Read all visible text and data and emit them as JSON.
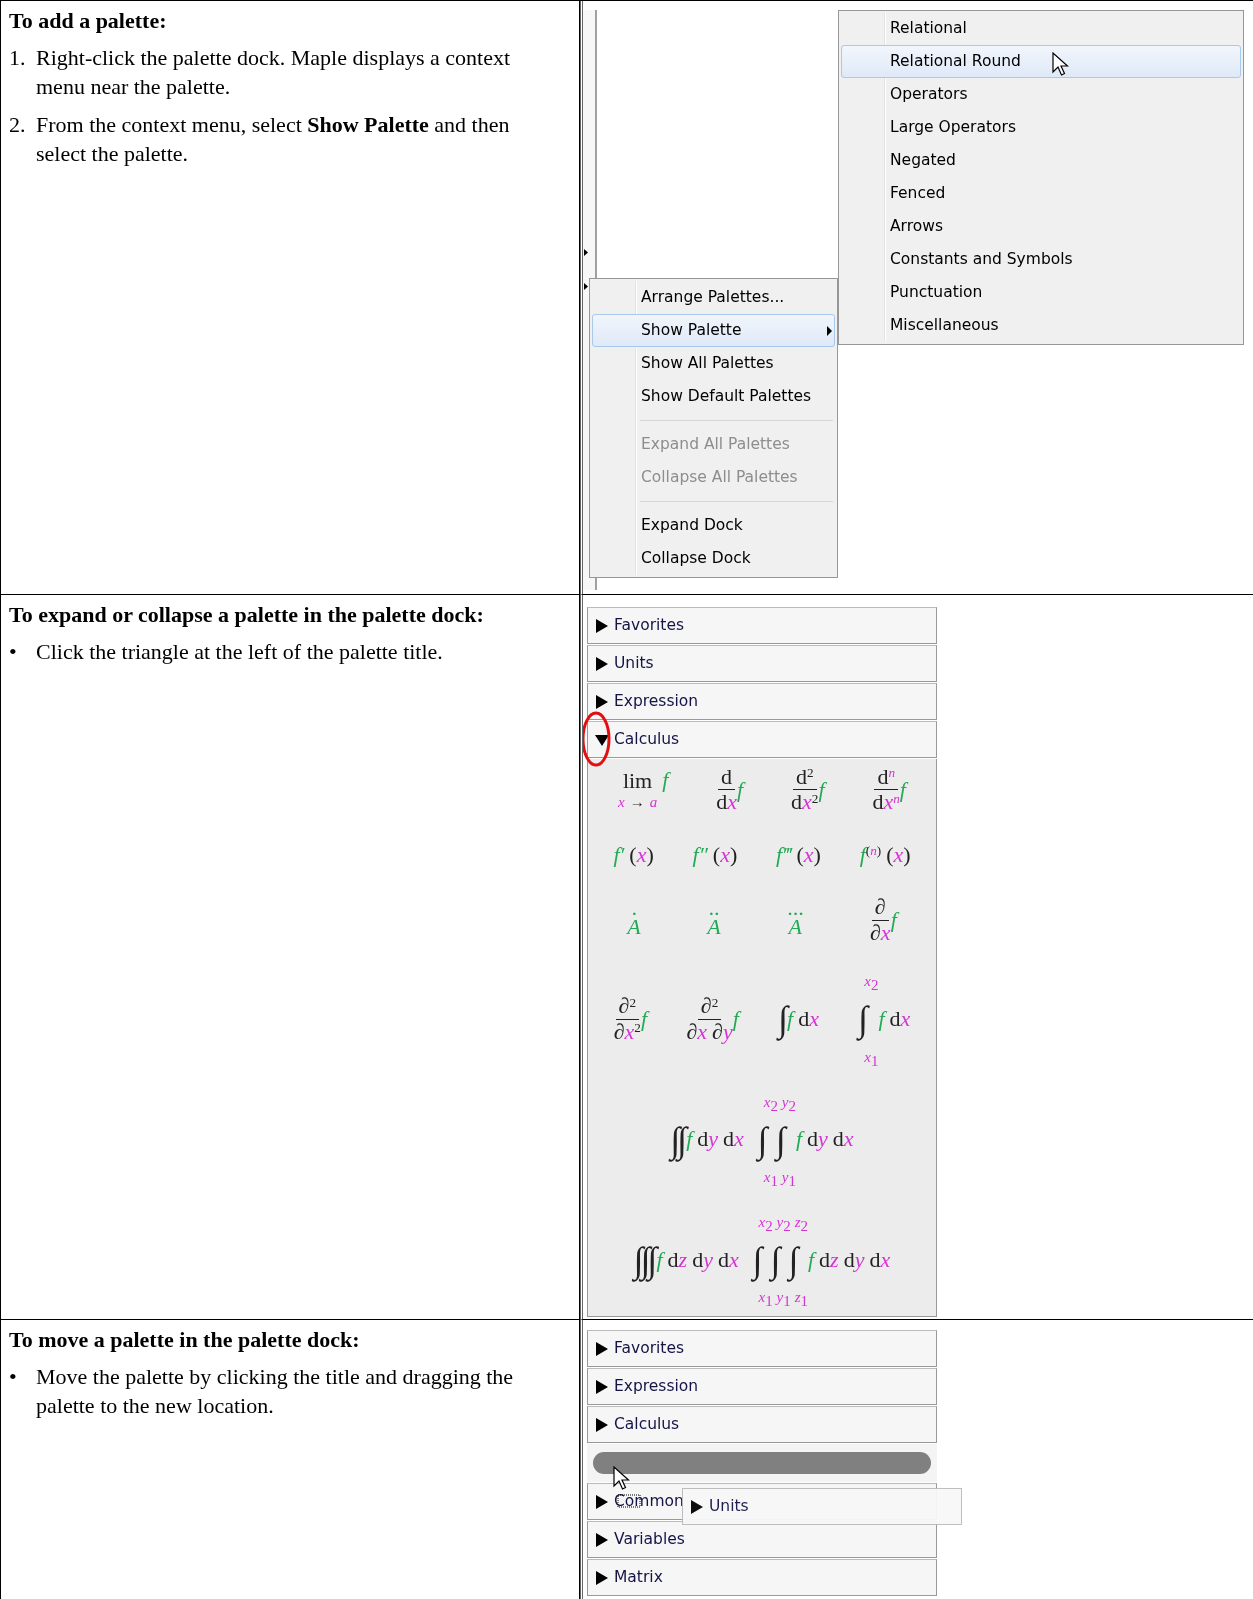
{
  "sections": [
    {
      "heading": "To add a palette:",
      "steps": [
        {
          "marker": "1.",
          "text": "Right-click the palette dock. Maple displays a context menu near the palette."
        },
        {
          "marker": "2.",
          "text": "From the context menu, select **Show Palette** and then select the palette."
        }
      ],
      "screenshot": {
        "kind": "context_menu",
        "menu_groups": [
          [
            {
              "label": "Arrange Palettes...",
              "selected": false,
              "disabled": false,
              "has_submenu": false
            },
            {
              "label": "Show Palette",
              "selected": true,
              "disabled": false,
              "has_submenu": true
            },
            {
              "label": "Show All Palettes",
              "selected": false,
              "disabled": false,
              "has_submenu": false
            },
            {
              "label": "Show Default Palettes",
              "selected": false,
              "disabled": false,
              "has_submenu": false
            }
          ],
          [
            {
              "label": "Expand All Palettes",
              "selected": false,
              "disabled": true,
              "has_submenu": false
            },
            {
              "label": "Collapse All Palettes",
              "selected": false,
              "disabled": true,
              "has_submenu": false
            }
          ],
          [
            {
              "label": "Expand Dock",
              "selected": false,
              "disabled": false,
              "has_submenu": false
            },
            {
              "label": "Collapse Dock",
              "selected": false,
              "disabled": false,
              "has_submenu": false
            }
          ]
        ],
        "submenu": [
          {
            "label": "Relational",
            "selected": false
          },
          {
            "label": "Relational Round",
            "selected": true
          },
          {
            "label": "Operators",
            "selected": false
          },
          {
            "label": "Large Operators",
            "selected": false
          },
          {
            "label": "Negated",
            "selected": false
          },
          {
            "label": "Fenced",
            "selected": false
          },
          {
            "label": "Arrows",
            "selected": false
          },
          {
            "label": "Constants and Symbols",
            "selected": false
          },
          {
            "label": "Punctuation",
            "selected": false
          },
          {
            "label": "Miscellaneous",
            "selected": false
          }
        ]
      }
    },
    {
      "heading": "To expand or collapse a palette in the palette dock:",
      "steps": [
        {
          "marker": "•",
          "text": "Click the triangle at the left of the palette title."
        }
      ],
      "screenshot": {
        "kind": "palette_dock",
        "palettes": [
          {
            "kind": "header",
            "label": "Favorites",
            "expanded": false
          },
          {
            "kind": "header",
            "label": "Units",
            "expanded": false
          },
          {
            "kind": "header",
            "label": "Expression",
            "expanded": false
          },
          {
            "kind": "header",
            "label": "Calculus",
            "expanded": true,
            "template_rows": [
              [
                {
                  "kind": "limit",
                  "op": "lim",
                  "under": [
                    {
                      "t": "x",
                      "kind": "var"
                    },
                    {
                      "t": "→",
                      "kind": "spaced"
                    },
                    {
                      "t": "a",
                      "kind": "spacedvar"
                    }
                  ],
                  "fn": "f"
                },
                {
                  "kind": "fraction",
                  "num": [
                    {
                      "t": "d",
                      "kind": "plain"
                    }
                  ],
                  "den": [
                    {
                      "t": "d",
                      "kind": "plain"
                    },
                    {
                      "t": "x",
                      "kind": "var"
                    }
                  ],
                  "fn": "f"
                },
                {
                  "kind": "fraction",
                  "num": [
                    {
                      "t": "d",
                      "kind": "plain"
                    },
                    {
                      "t": "2",
                      "kind": "sup"
                    }
                  ],
                  "den": [
                    {
                      "t": "d",
                      "kind": "plain"
                    },
                    {
                      "t": "x",
                      "kind": "var"
                    },
                    {
                      "t": "2",
                      "kind": "sup"
                    }
                  ],
                  "fn": "f"
                },
                {
                  "kind": "fraction",
                  "num": [
                    {
                      "t": "d",
                      "kind": "plain"
                    },
                    {
                      "t": "n",
                      "kind": "supvar"
                    }
                  ],
                  "den": [
                    {
                      "t": "d",
                      "kind": "plain"
                    },
                    {
                      "t": "x",
                      "kind": "var"
                    },
                    {
                      "t": "n",
                      "kind": "supvar"
                    }
                  ],
                  "fn": "f"
                }
              ],
              [
                {
                  "kind": "expr",
                  "parts": [
                    {
                      "t": "f′",
                      "kind": "fn"
                    },
                    {
                      "t": "(",
                      "kind": "spaced"
                    },
                    {
                      "t": "x",
                      "kind": "var"
                    },
                    {
                      "t": ")",
                      "kind": "plain"
                    }
                  ]
                },
                {
                  "kind": "expr",
                  "parts": [
                    {
                      "t": "f″",
                      "kind": "fn"
                    },
                    {
                      "t": "(",
                      "kind": "spaced"
                    },
                    {
                      "t": "x",
                      "kind": "var"
                    },
                    {
                      "t": ")",
                      "kind": "plain"
                    }
                  ]
                },
                {
                  "kind": "expr",
                  "parts": [
                    {
                      "t": "f‴",
                      "kind": "fn"
                    },
                    {
                      "t": "(",
                      "kind": "spaced"
                    },
                    {
                      "t": "x",
                      "kind": "var"
                    },
                    {
                      "t": ")",
                      "kind": "plain"
                    }
                  ]
                },
                {
                  "kind": "expr",
                  "parts": [
                    {
                      "t": "f",
                      "kind": "fn"
                    },
                    {
                      "t": "(",
                      "kind": "sup"
                    },
                    {
                      "t": "n",
                      "kind": "supvar"
                    },
                    {
                      "t": ")",
                      "kind": "sup"
                    },
                    {
                      "t": "(",
                      "kind": "spaced"
                    },
                    {
                      "t": "x",
                      "kind": "var"
                    },
                    {
                      "t": ")",
                      "kind": "plain"
                    }
                  ]
                }
              ],
              [
                {
                  "kind": "accent",
                  "accent": "·",
                  "base": "A"
                },
                {
                  "kind": "accent",
                  "accent": "··",
                  "base": "A"
                },
                {
                  "kind": "accent",
                  "accent": "···",
                  "base": "A"
                },
                {
                  "kind": "fraction",
                  "num": [
                    {
                      "t": "∂",
                      "kind": "plain"
                    }
                  ],
                  "den": [
                    {
                      "t": "∂",
                      "kind": "plain"
                    },
                    {
                      "t": "x",
                      "kind": "var"
                    }
                  ],
                  "fn": "f"
                }
              ],
              [
                {
                  "kind": "fraction",
                  "num": [
                    {
                      "t": "∂",
                      "kind": "plain"
                    },
                    {
                      "t": "2",
                      "kind": "sup"
                    }
                  ],
                  "den": [
                    {
                      "t": "∂",
                      "kind": "plain"
                    },
                    {
                      "t": "x",
                      "kind": "var"
                    },
                    {
                      "t": "2",
                      "kind": "sup"
                    }
                  ],
                  "fn": "f"
                },
                {
                  "kind": "fraction",
                  "num": [
                    {
                      "t": "∂",
                      "kind": "plain"
                    },
                    {
                      "t": "2",
                      "kind": "sup"
                    }
                  ],
                  "den": [
                    {
                      "t": "∂",
                      "kind": "plain"
                    },
                    {
                      "t": "x",
                      "kind": "var"
                    },
                    {
                      "t": "∂",
                      "kind": "spaced"
                    },
                    {
                      "t": "y",
                      "kind": "var"
                    }
                  ],
                  "fn": "f"
                },
                {
                  "kind": "integral",
                  "signs": [
                    {
                      "sign": "∫"
                    }
                  ],
                  "parts": [
                    {
                      "t": "f",
                      "kind": "fn"
                    },
                    {
                      "t": "d",
                      "kind": "spaced"
                    },
                    {
                      "t": "x",
                      "kind": "var"
                    }
                  ]
                },
                {
                  "kind": "integral",
                  "signs": [
                    {
                      "sign": "∫",
                      "upper": [
                        {
                          "t": "x",
                          "kind": "var"
                        },
                        {
                          "t": "2",
                          "kind": "sub"
                        }
                      ],
                      "lower": [
                        {
                          "t": "x",
                          "kind": "var"
                        },
                        {
                          "t": "1",
                          "kind": "sub"
                        }
                      ]
                    }
                  ],
                  "parts": [
                    {
                      "t": "f",
                      "kind": "fn"
                    },
                    {
                      "t": "d",
                      "kind": "spaced"
                    },
                    {
                      "t": "x",
                      "kind": "var"
                    }
                  ]
                }
              ],
              [
                {
                  "kind": "integral",
                  "signs": [
                    {
                      "sign": "∫"
                    },
                    {
                      "sign": "∫"
                    }
                  ],
                  "parts": [
                    {
                      "t": "f",
                      "kind": "fn"
                    },
                    {
                      "t": "d",
                      "kind": "spaced"
                    },
                    {
                      "t": "y",
                      "kind": "var"
                    },
                    {
                      "t": "d",
                      "kind": "spaced"
                    },
                    {
                      "t": "x",
                      "kind": "var"
                    }
                  ]
                },
                {
                  "kind": "integral",
                  "signs": [
                    {
                      "sign": "∫",
                      "upper": [
                        {
                          "t": "x",
                          "kind": "var"
                        },
                        {
                          "t": "2",
                          "kind": "sub"
                        }
                      ],
                      "lower": [
                        {
                          "t": "x",
                          "kind": "var"
                        },
                        {
                          "t": "1",
                          "kind": "sub"
                        }
                      ]
                    },
                    {
                      "sign": "∫",
                      "upper": [
                        {
                          "t": "y",
                          "kind": "var"
                        },
                        {
                          "t": "2",
                          "kind": "sub"
                        }
                      ],
                      "lower": [
                        {
                          "t": "y",
                          "kind": "var"
                        },
                        {
                          "t": "1",
                          "kind": "sub"
                        }
                      ]
                    }
                  ],
                  "parts": [
                    {
                      "t": "f",
                      "kind": "fn"
                    },
                    {
                      "t": "d",
                      "kind": "spaced"
                    },
                    {
                      "t": "y",
                      "kind": "var"
                    },
                    {
                      "t": "d",
                      "kind": "spaced"
                    },
                    {
                      "t": "x",
                      "kind": "var"
                    }
                  ]
                }
              ],
              [
                {
                  "kind": "integral",
                  "signs": [
                    {
                      "sign": "∫"
                    },
                    {
                      "sign": "∫"
                    },
                    {
                      "sign": "∫"
                    }
                  ],
                  "parts": [
                    {
                      "t": "f",
                      "kind": "fn"
                    },
                    {
                      "t": "d",
                      "kind": "spaced"
                    },
                    {
                      "t": "z",
                      "kind": "var"
                    },
                    {
                      "t": "d",
                      "kind": "spaced"
                    },
                    {
                      "t": "y",
                      "kind": "var"
                    },
                    {
                      "t": "d",
                      "kind": "spaced"
                    },
                    {
                      "t": "x",
                      "kind": "var"
                    }
                  ]
                },
                {
                  "kind": "integral",
                  "signs": [
                    {
                      "sign": "∫",
                      "upper": [
                        {
                          "t": "x",
                          "kind": "var"
                        },
                        {
                          "t": "2",
                          "kind": "sub"
                        }
                      ],
                      "lower": [
                        {
                          "t": "x",
                          "kind": "var"
                        },
                        {
                          "t": "1",
                          "kind": "sub"
                        }
                      ]
                    },
                    {
                      "sign": "∫",
                      "upper": [
                        {
                          "t": "y",
                          "kind": "var"
                        },
                        {
                          "t": "2",
                          "kind": "sub"
                        }
                      ],
                      "lower": [
                        {
                          "t": "y",
                          "kind": "var"
                        },
                        {
                          "t": "1",
                          "kind": "sub"
                        }
                      ]
                    },
                    {
                      "sign": "∫",
                      "upper": [
                        {
                          "t": "z",
                          "kind": "var"
                        },
                        {
                          "t": "2",
                          "kind": "sub"
                        }
                      ],
                      "lower": [
                        {
                          "t": "z",
                          "kind": "var"
                        },
                        {
                          "t": "1",
                          "kind": "sub"
                        }
                      ]
                    }
                  ],
                  "parts": [
                    {
                      "t": "f",
                      "kind": "fn"
                    },
                    {
                      "t": "d",
                      "kind": "spaced"
                    },
                    {
                      "t": "z",
                      "kind": "var"
                    },
                    {
                      "t": "d",
                      "kind": "spaced"
                    },
                    {
                      "t": "y",
                      "kind": "var"
                    },
                    {
                      "t": "d",
                      "kind": "spaced"
                    },
                    {
                      "t": "x",
                      "kind": "var"
                    }
                  ]
                }
              ]
            ]
          }
        ]
      }
    },
    {
      "heading": "To move a palette in the palette dock:",
      "steps": [
        {
          "marker": "•",
          "text": "Move the palette by clicking the title and dragging the palette to the new location."
        }
      ],
      "screenshot": {
        "kind": "palette_drag",
        "palettes": [
          {
            "kind": "header",
            "label": "Favorites",
            "expanded": false
          },
          {
            "kind": "header",
            "label": "Expression",
            "expanded": false
          },
          {
            "kind": "header",
            "label": "Calculus",
            "expanded": false
          },
          {
            "kind": "drop_target"
          },
          {
            "kind": "header",
            "label": "Common",
            "expanded": false
          },
          {
            "kind": "header",
            "label": "Variables",
            "expanded": false
          },
          {
            "kind": "header",
            "label": "Matrix",
            "expanded": false
          }
        ],
        "dragged": {
          "label": "Units",
          "expanded": false
        }
      }
    }
  ]
}
